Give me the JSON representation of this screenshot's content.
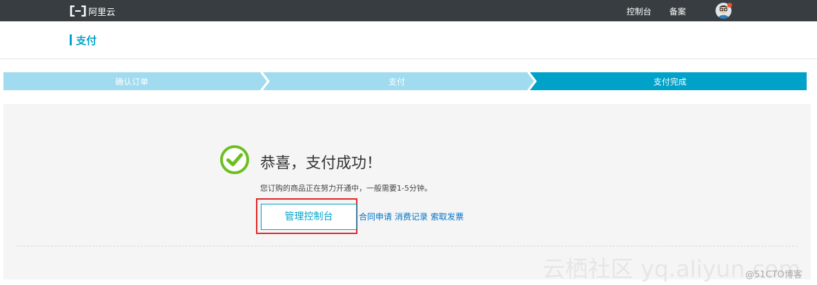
{
  "topbar": {
    "logo_text": "阿里云",
    "nav": [
      "控制台",
      "备案"
    ]
  },
  "page": {
    "title": "支付"
  },
  "steps": [
    {
      "label": "确认订单",
      "state": "done"
    },
    {
      "label": "支付",
      "state": "done"
    },
    {
      "label": "支付完成",
      "state": "current"
    }
  ],
  "result": {
    "title": "恭喜，支付成功！",
    "subtitle": "您订购的商品正在努力开通中，一般需要1-5分钟。",
    "console_button": "管理控制台",
    "links": [
      "合同申请",
      "消费记录",
      "索取发票"
    ]
  },
  "watermark": {
    "main": "云栖社区 yq.aliyun.com",
    "credit": "@51CTO博客"
  },
  "colors": {
    "topbar": "#373d41",
    "accent": "#00a2ca",
    "step_done": "#a0dbef",
    "step_current": "#00a2ca",
    "success_green": "#6cbf1e",
    "highlight_red": "#e02424",
    "link": "#0073c7"
  },
  "icons": {
    "logo": "aliyun-logo-icon",
    "avatar": "user-avatar-icon",
    "success": "check-circle-icon"
  }
}
